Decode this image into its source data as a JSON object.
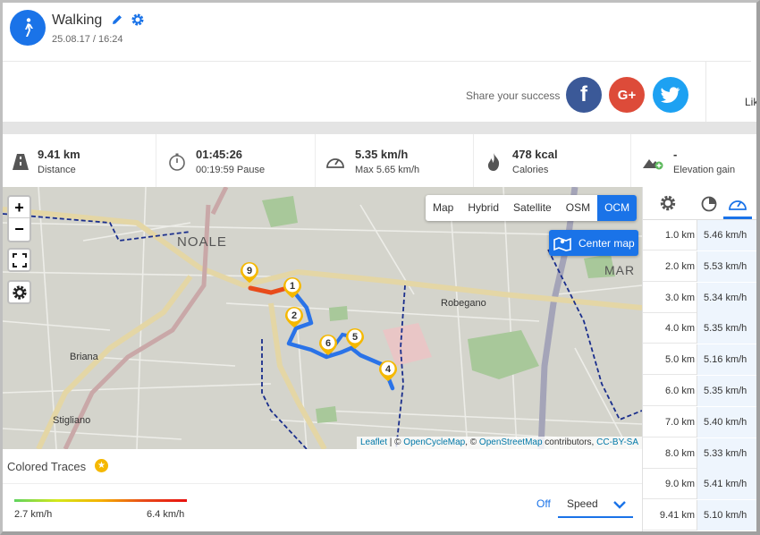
{
  "activity": {
    "title": "Walking",
    "datetime": "25.08.17 / 16:24"
  },
  "share": {
    "text": "Share your success",
    "facebook": "f",
    "google": "G+",
    "like": "Lik"
  },
  "stats": [
    {
      "value": "9.41 km",
      "label": "Distance",
      "icon": "road-icon"
    },
    {
      "value": "01:45:26",
      "label": "00:19:59 Pause",
      "icon": "stopwatch-icon"
    },
    {
      "value": "5.35 km/h",
      "label": "Max 5.65 km/h",
      "icon": "speedometer-icon"
    },
    {
      "value": "478 kcal",
      "label": "Calories",
      "icon": "flame-icon"
    },
    {
      "value": "-",
      "label": "Elevation gain",
      "icon": "mountain-icon"
    }
  ],
  "map": {
    "layers": [
      "Map",
      "Hybrid",
      "Satellite",
      "OSM",
      "OCM"
    ],
    "active_layer": "OCM",
    "center_button": "Center map",
    "zoom_in": "+",
    "zoom_out": "−",
    "places": {
      "noale": "NOALE",
      "robegano": "Robegano",
      "briana": "Briana",
      "stigliano": "Stigliano",
      "mar": "MAR"
    },
    "markers": [
      "9",
      "1",
      "2",
      "6",
      "5",
      "4"
    ],
    "attribution": {
      "leaflet": "Leaflet",
      "sep1": " | © ",
      "ocm": "OpenCycleMap",
      "sep2": ", © ",
      "osm": "OpenStreetMap",
      "mid": " contributors, ",
      "license": "CC-BY-SA"
    }
  },
  "laps": [
    {
      "distance": "1.0 km",
      "speed": "5.46 km/h"
    },
    {
      "distance": "2.0 km",
      "speed": "5.53 km/h"
    },
    {
      "distance": "3.0 km",
      "speed": "5.34 km/h"
    },
    {
      "distance": "4.0 km",
      "speed": "5.35 km/h"
    },
    {
      "distance": "5.0 km",
      "speed": "5.16 km/h"
    },
    {
      "distance": "6.0 km",
      "speed": "5.35 km/h"
    },
    {
      "distance": "7.0 km",
      "speed": "5.40 km/h"
    },
    {
      "distance": "8.0 km",
      "speed": "5.33 km/h"
    },
    {
      "distance": "9.0 km",
      "speed": "5.41 km/h"
    },
    {
      "distance": "9.41 km",
      "speed": "5.10 km/h"
    }
  ],
  "traces": {
    "title": "Colored Traces",
    "min": "2.7 km/h",
    "max": "6.4 km/h",
    "off": "Off",
    "mode": "Speed"
  },
  "colors": {
    "accent": "#1a73e8",
    "facebook": "#3b5998",
    "google": "#dd4b39",
    "twitter": "#1da1f2",
    "route": "#2a73e8",
    "marker": "#f5b800"
  }
}
